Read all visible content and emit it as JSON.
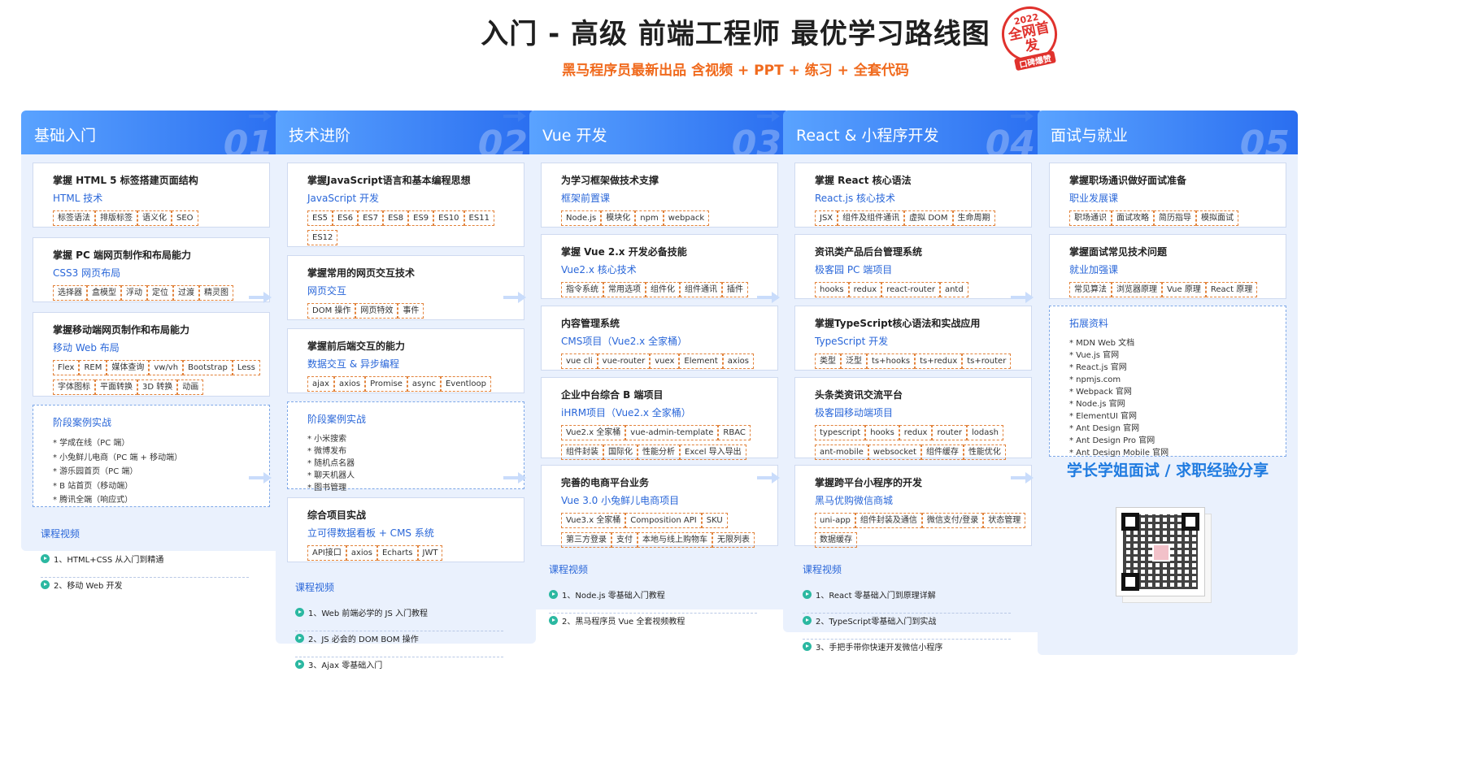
{
  "title": "入门 - 高级 前端工程师 最优学习路线图",
  "stamp": {
    "year": "2022",
    "main": "全网首发",
    "sub": "口碑爆赞"
  },
  "subtitle": "黑马程序员最新出品 含视频 + PPT + 练习 + 全套代码",
  "columns": [
    {
      "name": "基础入门",
      "num": "01",
      "cards": [
        {
          "title": "掌握 HTML 5 标签搭建页面结构",
          "sub": "HTML 技术",
          "tags": [
            "标签语法",
            "排版标签",
            "语义化",
            "SEO"
          ]
        },
        {
          "title": "掌握 PC 端网页制作和布局能力",
          "sub": "CSS3 网页布局",
          "tags": [
            "选择器",
            "盒模型",
            "浮动",
            "定位",
            "过渡",
            "精灵图"
          ]
        },
        {
          "title": "掌握移动端网页制作和布局能力",
          "sub": "移动 Web 布局",
          "tags": [
            "Flex",
            "REM",
            "媒体查询",
            "vw/vh",
            "Bootstrap",
            "Less",
            "字体图标",
            "平面转换",
            "3D 转换",
            "动画"
          ]
        }
      ],
      "box": {
        "title": "阶段案例实战",
        "items": [
          "* 学成在线（PC 端）",
          "* 小兔鲜儿电商（PC 端 + 移动端）",
          "* 游乐园首页（PC 端）",
          "* B 站首页（移动端）",
          "* 腾讯全端（响应式）"
        ]
      },
      "videos": {
        "title": "课程视频",
        "items": [
          "1、HTML+CSS 从入门到精通",
          "2、移动 Web 开发"
        ]
      }
    },
    {
      "name": "技术进阶",
      "num": "02",
      "cards": [
        {
          "title": "掌握JavaScript语言和基本编程思想",
          "sub": "JavaScript 开发",
          "tags": [
            "ES5",
            "ES6",
            "ES7",
            "ES8",
            "ES9",
            "ES10",
            "ES11",
            "ES12"
          ]
        },
        {
          "title": "掌握常用的网页交互技术",
          "sub": "网页交互",
          "tags": [
            "DOM 操作",
            "网页特效",
            "事件"
          ]
        },
        {
          "title": "掌握前后端交互的能力",
          "sub": "数据交互 & 异步编程",
          "tags": [
            "ajax",
            "axios",
            "Promise",
            "async",
            "Eventloop"
          ]
        }
      ],
      "box": {
        "title": "阶段案例实战",
        "items": [
          "* 小米搜索",
          "* 微博发布",
          "* 随机点名器",
          "* 聊天机器人",
          "* 图书管理"
        ]
      },
      "cards2": [
        {
          "title": "综合项目实战",
          "sub": "立可得数据看板 + CMS 系统",
          "tags": [
            "API接口",
            "axios",
            "Echarts",
            "JWT"
          ]
        }
      ],
      "videos": {
        "title": "课程视频",
        "items": [
          "1、Web 前端必学的 JS 入门教程",
          "2、JS 必会的 DOM BOM 操作",
          "3、Ajax 零基础入门"
        ]
      }
    },
    {
      "name": "Vue 开发",
      "num": "03",
      "cards": [
        {
          "title": "为学习框架做技术支撑",
          "sub": "框架前置课",
          "tags": [
            "Node.js",
            "模块化",
            "npm",
            "webpack"
          ]
        },
        {
          "title": "掌握 Vue 2.x 开发必备技能",
          "sub": "Vue2.x 核心技术",
          "tags": [
            "指令系统",
            "常用选项",
            "组件化",
            "组件通讯",
            "插件"
          ]
        },
        {
          "title": "内容管理系统",
          "sub": "CMS项目（Vue2.x 全家桶）",
          "tags": [
            "vue cli",
            "vue-router",
            "vuex",
            "Element",
            "axios"
          ]
        },
        {
          "title": "企业中台综合 B 端项目",
          "sub": "iHRM项目（Vue2.x 全家桶）",
          "tags": [
            "Vue2.x 全家桶",
            "vue-admin-template",
            "RBAC",
            "组件封装",
            "国际化",
            "性能分析",
            "Excel 导入导出"
          ]
        },
        {
          "title": "完善的电商平台业务",
          "sub": "Vue 3.0 小兔鲜儿电商项目",
          "tags": [
            "Vue3.x 全家桶",
            "Composition API",
            "SKU",
            "第三方登录",
            "支付",
            "本地与线上购物车",
            "无限列表"
          ]
        }
      ],
      "videos": {
        "title": "课程视频",
        "items": [
          "1、Node.js 零基础入门教程",
          "2、黑马程序员 Vue 全套视频教程"
        ]
      }
    },
    {
      "name": "React & 小程序开发",
      "num": "04",
      "cards": [
        {
          "title": "掌握 React 核心语法",
          "sub": "React.js 核心技术",
          "tags": [
            "JSX",
            "组件及组件通讯",
            "虚拟 DOM",
            "生命周期"
          ]
        },
        {
          "title": "资讯类产品后台管理系统",
          "sub": "极客园 PC 端项目",
          "tags": [
            "hooks",
            "redux",
            "react-router",
            "antd"
          ]
        },
        {
          "title": "掌握TypeScript核心语法和实战应用",
          "sub": "TypeScript 开发",
          "tags": [
            "类型",
            "泛型",
            "ts+hooks",
            "ts+redux",
            "ts+router"
          ]
        },
        {
          "title": "头条类资讯交流平台",
          "sub": "极客园移动端项目",
          "tags": [
            "typescript",
            "hooks",
            "redux",
            "router",
            "lodash",
            "ant-mobile",
            "websocket",
            "组件缓存",
            "性能优化"
          ]
        },
        {
          "title": "掌握跨平台小程序的开发",
          "sub": "黑马优购微信商城",
          "tags": [
            "uni-app",
            "组件封装及通信",
            "微信支付/登录",
            "状态管理",
            "数据缓存"
          ]
        }
      ],
      "videos": {
        "title": "课程视频",
        "items": [
          "1、React 零基础入门到原理详解",
          "2、TypeScript零基础入门到实战",
          "3、手把手带你快速开发微信小程序"
        ]
      }
    },
    {
      "name": "面试与就业",
      "num": "05",
      "cards": [
        {
          "title": "掌握职场通识做好面试准备",
          "sub": "职业发展课",
          "tags": [
            "职场通识",
            "面试攻略",
            "简历指导",
            "模拟面试"
          ]
        },
        {
          "title": "掌握面试常见技术问题",
          "sub": "就业加强课",
          "tags": [
            "常见算法",
            "浏览器原理",
            "Vue 原理",
            "React 原理"
          ]
        }
      ],
      "box": {
        "title": "拓展资料",
        "items": [
          "* MDN Web 文档",
          "* Vue.js 官网",
          "* React.js 官网",
          "* npmjs.com",
          "* Webpack 官网",
          "* Node.js 官网",
          "* ElementUI 官网",
          "* Ant Design 官网",
          "* Ant Design Pro 官网",
          "* Ant Design Mobile 官网"
        ]
      },
      "share": "学长学姐面试 / 求职经验分享"
    }
  ]
}
